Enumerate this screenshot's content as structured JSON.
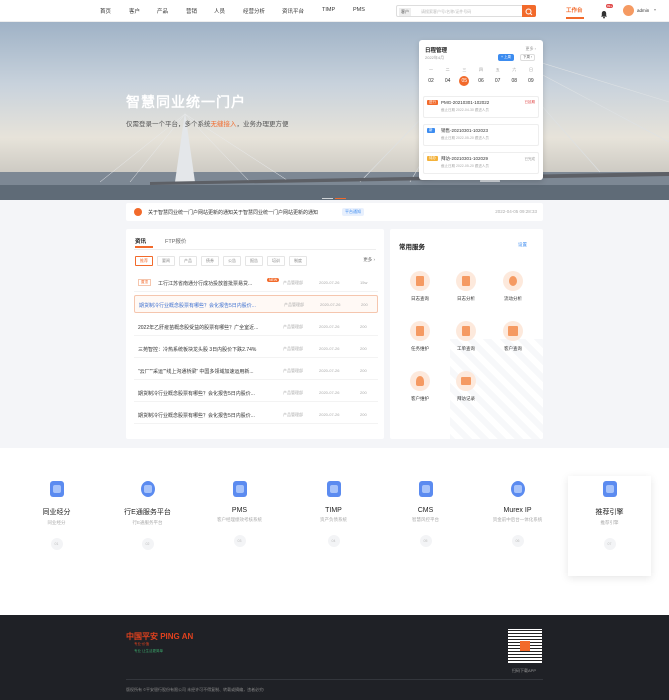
{
  "nav": {
    "items": [
      "首页",
      "客户",
      "产品",
      "营销",
      "人员",
      "经营分析",
      "资讯平台",
      "TIMP",
      "PMS"
    ],
    "search_scope": "客户",
    "search_placeholder": "请搜索客户号/名称/证件号码",
    "workbench": "工作台",
    "badge": "99+",
    "user": "admin"
  },
  "hero": {
    "title": "智慧同业统一门户",
    "subtitle_pre": "仅需登录一个平台，多个系统",
    "subtitle_hl": "无缝接入",
    "subtitle_post": "，业务办理更方便"
  },
  "calendar": {
    "title": "日程管理",
    "more": "更多 ›",
    "month": "2022年4月",
    "btn_add": "+ 上周",
    "btn_next": "下周 ›",
    "weekdays": [
      "一",
      "二",
      "三",
      "四",
      "五",
      "六",
      "日"
    ],
    "days": [
      "02",
      "04",
      "05",
      "06",
      "07",
      "08",
      "09"
    ],
    "selected_index": 2,
    "events": [
      {
        "tag": "进行",
        "tag_color": "#f26a2b",
        "name": "PMG-20210301-102022",
        "desc": "截止日期 2022-04-30    跟进人员",
        "flag": "已延期"
      },
      {
        "tag": "新",
        "tag_color": "#3c8cf0",
        "name": "销售-20210301-102023",
        "desc": "截止日期 2022-05-20    跟进人员",
        "flag": ""
      },
      {
        "tag": "待办",
        "tag_color": "#f4b23a",
        "name": "拜访-20210301-102029",
        "desc": "截止日期 2022-05-20    跟进人员",
        "flag": "已完成"
      }
    ]
  },
  "notice": {
    "text": "关于智慧同业统一门户网站更新的通知关于智慧同业统一门户网站更新的通知",
    "badge": "平台通知",
    "time": "2022-04-05 09:28:33"
  },
  "news": {
    "tabs": [
      "资讯",
      "FTP报价"
    ],
    "filters": [
      "推荐",
      "要闻",
      "产品",
      "债券",
      "公告",
      "报告",
      "培训",
      "制度"
    ],
    "more": "更多 ›",
    "rows": [
      {
        "pin": "置顶",
        "title": "工行江苏省南通分行成功投放首批票易贷...",
        "new": "NEW",
        "source": "产品管理部",
        "date": "2020-07-26",
        "views": "15w"
      },
      {
        "title": "期货制冷行业概念股票有哪些？会化报告5日内股价...",
        "source": "产品管理部",
        "date": "2020-07-26",
        "views": "200"
      },
      {
        "title": "2022年乙肝疫苗概念股受益的股票有哪些？广全室近...",
        "source": "产品管理部",
        "date": "2020-07-26",
        "views": "200"
      },
      {
        "title": "三苑智控：冷热系统板块龙头股 3日内股价下跌2.74%",
        "source": "产品管理部",
        "date": "2020-07-26",
        "views": "200"
      },
      {
        "title": "“云厂”“采运”“线上沟通桥梁” 中国多领域加速运用新...",
        "source": "产品管理部",
        "date": "2020-07-26",
        "views": "200"
      },
      {
        "title": "期货制冷行业概念股票有哪些？会化报告5日内股价...",
        "source": "产品管理部",
        "date": "2020-07-26",
        "views": "200"
      },
      {
        "title": "期货制冷行业概念股票有哪些？会化报告5日内股价...",
        "source": "产品管理部",
        "date": "2020-07-26",
        "views": "200"
      }
    ]
  },
  "services": {
    "title": "常用服务",
    "settings": "设置",
    "items": [
      "日志查询",
      "日志分析",
      "流动分析",
      "任务维护",
      "工单查询",
      "客户查询",
      "客户维护",
      "拜访记录"
    ]
  },
  "products": [
    {
      "name": "同业经分",
      "desc": "同业经分",
      "no": "01"
    },
    {
      "name": "行E通服务平台",
      "desc": "行E通服务平台",
      "no": "02"
    },
    {
      "name": "PMS",
      "desc": "客户经理绩效考核系统",
      "no": "03"
    },
    {
      "name": "TIMP",
      "desc": "资产负债系统",
      "no": "04"
    },
    {
      "name": "CMS",
      "desc": "智慧风控平台",
      "no": "05"
    },
    {
      "name": "Murex IP",
      "desc": "资金前中后台一体化系统",
      "no": "06"
    },
    {
      "name": "推荐引擎",
      "desc": "推荐引擎",
      "no": "07"
    }
  ],
  "footer": {
    "brand": "中国平安 PING AN",
    "brand_sub": "专业·价值",
    "slogan": "专业 让生活更简单",
    "qr_text": "扫码下载APP",
    "copyright": "版权所有 ©平安银行股份有限公司 未经许可不得复制、转载或摘编，违者必究!"
  },
  "colors": {
    "accent": "#f26a2b",
    "link": "#3c8cf0"
  }
}
